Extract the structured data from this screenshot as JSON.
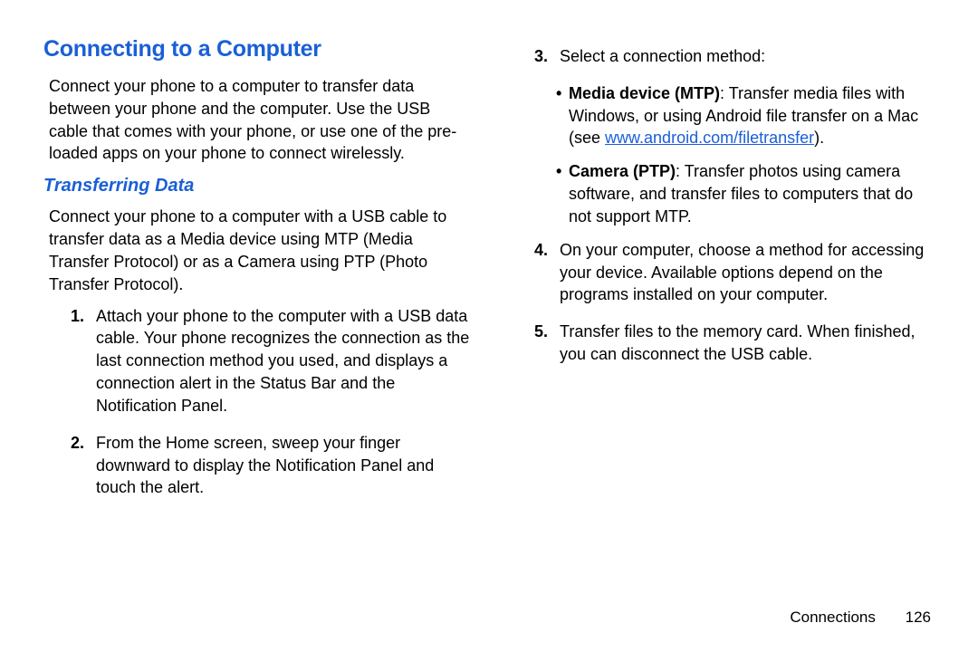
{
  "heading": "Connecting to a Computer",
  "intro": "Connect your phone to a computer to transfer data between your phone and the computer. Use the USB cable that comes with your phone, or use one of the pre-loaded apps on your phone to connect wirelessly.",
  "subheading": "Transferring Data",
  "sub_intro": "Connect your phone to a computer with a USB cable to transfer data as a Media device using MTP (Media Transfer Protocol) or as a Camera using PTP (Photo Transfer Protocol).",
  "steps": {
    "s1_num": "1.",
    "s1": "Attach your phone to the computer with a USB data cable. Your phone recognizes the connection as the last connection method you used, and displays a connection alert in the Status Bar and the Notification Panel.",
    "s2_num": "2.",
    "s2": "From the Home screen, sweep your finger downward to display the Notification Panel and touch the alert.",
    "s3_num": "3.",
    "s3": "Select a connection method:",
    "s4_num": "4.",
    "s4": "On your computer, choose a method for accessing your device. Available options depend on the programs installed on your computer.",
    "s5_num": "5.",
    "s5": "Transfer files to the memory card. When finished, you can disconnect the USB cable."
  },
  "bullets": {
    "mtp_label": "Media device (MTP)",
    "mtp_text_a": ": Transfer media files with Windows, or using Android file transfer on a Mac (see ",
    "mtp_link": "www.android.com/filetransfer",
    "mtp_text_b": ").",
    "ptp_label": "Camera (PTP)",
    "ptp_text": ": Transfer photos using camera software, and transfer files to computers that do not support MTP."
  },
  "footer": {
    "section": "Connections",
    "page": "126"
  }
}
